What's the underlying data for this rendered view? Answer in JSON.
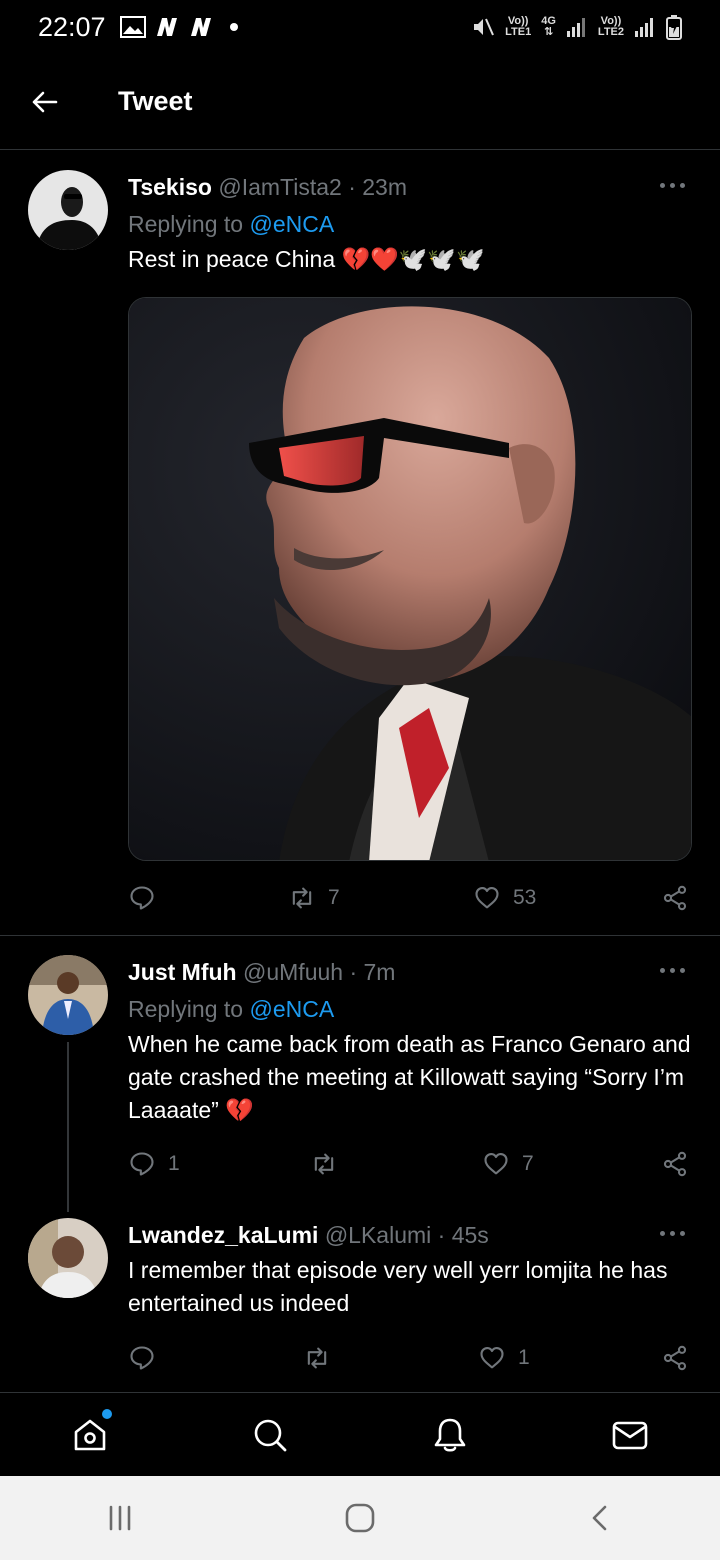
{
  "status_bar": {
    "time": "22:07",
    "left_icons": [
      "image-icon",
      "n-icon",
      "n-icon",
      "dot-icon"
    ],
    "sim1_top": "Vo))",
    "sim1_bottom": "LTE1",
    "network_top": "4G",
    "network_bottom": "⇅",
    "sim2_top": "Vo))",
    "sim2_bottom": "LTE2"
  },
  "header": {
    "title": "Tweet"
  },
  "tweets": [
    {
      "name": "Tsekiso",
      "handle": "@IamTista2",
      "time": "· 23m",
      "replying_prefix": "Replying to ",
      "replying_to": "@eNCA",
      "text": "Rest in peace China 💔❤️🕊️🕊️🕊️",
      "retweets": "7",
      "likes": "53"
    },
    {
      "name": "Just Mfuh",
      "handle": "@uMfuuh",
      "time": "· 7m",
      "replying_prefix": "Replying to ",
      "replying_to": "@eNCA",
      "text": "When he came back from death as Franco Genaro and gate crashed the meeting at Killowatt saying “Sorry I’m Laaaate” 💔",
      "replies": "1",
      "likes": "7"
    },
    {
      "name": "Lwandez_kaLumi",
      "handle": "@LKalumi",
      "time": "· 45s",
      "text": "I remember that episode very well yerr lomjita he has entertained us indeed",
      "likes": "1"
    }
  ],
  "colors": {
    "accent": "#1d9bf0",
    "muted": "#71767b",
    "background": "#000000",
    "heart": "#e0245e"
  }
}
